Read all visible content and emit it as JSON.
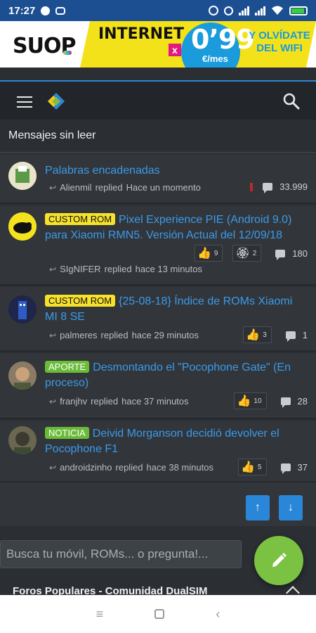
{
  "status_bar": {
    "time": "17:27"
  },
  "ad": {
    "brand": "SUOP",
    "headline": "INTERNET",
    "multiplier": "x",
    "price": "0’99",
    "price_unit": "€/mes",
    "slogan": "Y OLVÍDATE DEL WIFI"
  },
  "colors": {
    "accent": "#2f84d8",
    "link": "#3b9ae8",
    "fab": "#7cc242",
    "status_bar": "#1b4f92"
  },
  "section_title": "Mensajes sin leer",
  "threads": [
    {
      "prefix": "",
      "title": "Palabras encadenadas",
      "author": "Alienmil",
      "action": "replied",
      "time": "Hace un momento",
      "reactions": [],
      "replies": "33.999"
    },
    {
      "prefix": "CUSTOM ROM",
      "title": "Pixel Experience PIE (Android 9.0) para Xiaomi RMN5. Versión Actual del 12/09/18",
      "author": "SIgNIFER",
      "action": "replied",
      "time": "hace 13 minutos",
      "reactions": [
        {
          "icon": "like-icon",
          "count": "9"
        },
        {
          "icon": "award-icon",
          "count": "2"
        }
      ],
      "replies": "180"
    },
    {
      "prefix": "CUSTOM ROM",
      "title": "{25-08-18} Índice de ROMs Xiaomi MI 8 SE",
      "author": "palmeres",
      "action": "replied",
      "time": "hace 29 minutos",
      "reactions": [
        {
          "icon": "like-icon",
          "count": "3"
        }
      ],
      "replies": "1"
    },
    {
      "prefix": "APORTE",
      "title": "Desmontando el \"Pocophone Gate\" (En proceso)",
      "author": "franjhv",
      "action": "replied",
      "time": "hace 37 minutos",
      "reactions": [
        {
          "icon": "like-icon",
          "count": "10"
        }
      ],
      "replies": "28"
    },
    {
      "prefix": "NOTICIA",
      "title": "Deivid Morganson decidió devolver el Pocophone F1",
      "author": "androidzinho",
      "action": "replied",
      "time": "hace 38 minutos",
      "reactions": [
        {
          "icon": "like-icon",
          "count": "5"
        }
      ],
      "replies": "37"
    }
  ],
  "search": {
    "placeholder": "Busca tu móvil, ROMs... o pregunta!..."
  },
  "popular_title": "Foros Populares - Comunidad DualSIM"
}
